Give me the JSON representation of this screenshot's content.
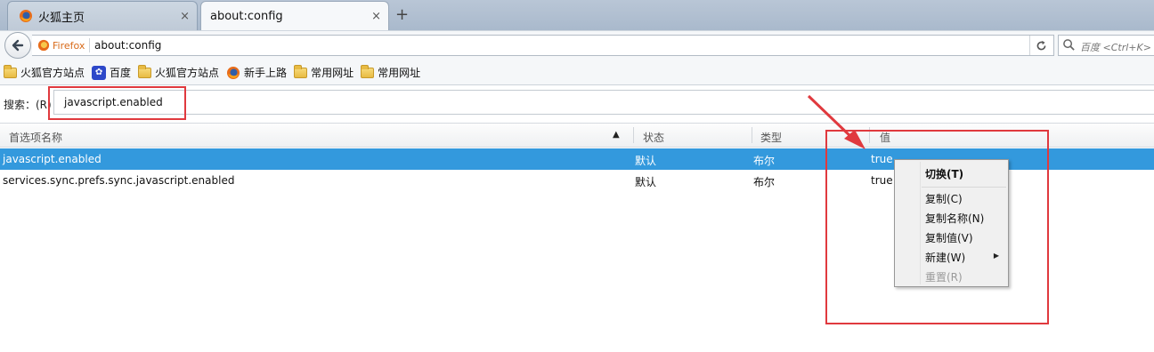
{
  "tabs": [
    {
      "label": "火狐主页",
      "close": "×"
    },
    {
      "label": "about:config",
      "close": "×"
    }
  ],
  "new_tab": "+",
  "navbar": {
    "identity_label": "Firefox",
    "url": "about:config",
    "search_placeholder": "百度 <Ctrl+K>"
  },
  "bookmarks": [
    {
      "label": "火狐官方站点",
      "icon": "folder-icon"
    },
    {
      "label": "百度",
      "icon": "baidu-paw-icon"
    },
    {
      "label": "火狐官方站点",
      "icon": "folder-icon"
    },
    {
      "label": "新手上路",
      "icon": "firefox-icon"
    },
    {
      "label": "常用网址",
      "icon": "folder-icon"
    },
    {
      "label": "常用网址",
      "icon": "folder-icon"
    }
  ],
  "search": {
    "label": "搜索：(R)",
    "value": "javascript.enabled"
  },
  "table": {
    "headers": [
      "首选项名称",
      "状态",
      "类型",
      "值"
    ],
    "sort_indicator": "▲",
    "rows": [
      {
        "name": "javascript.enabled",
        "status": "默认",
        "type": "布尔",
        "value": "true"
      },
      {
        "name": "services.sync.prefs.sync.javascript.enabled",
        "status": "默认",
        "type": "布尔",
        "value": "true"
      }
    ]
  },
  "context_menu": {
    "items": [
      {
        "label": "切换(T)"
      },
      {
        "label": "复制(C)"
      },
      {
        "label": "复制名称(N)"
      },
      {
        "label": "复制值(V)"
      },
      {
        "label": "新建(W)"
      },
      {
        "label": "重置(R)"
      }
    ]
  },
  "colors": {
    "selected_row": "#3399dd",
    "annotation": "#e0393e",
    "identity": "#d86a19"
  }
}
